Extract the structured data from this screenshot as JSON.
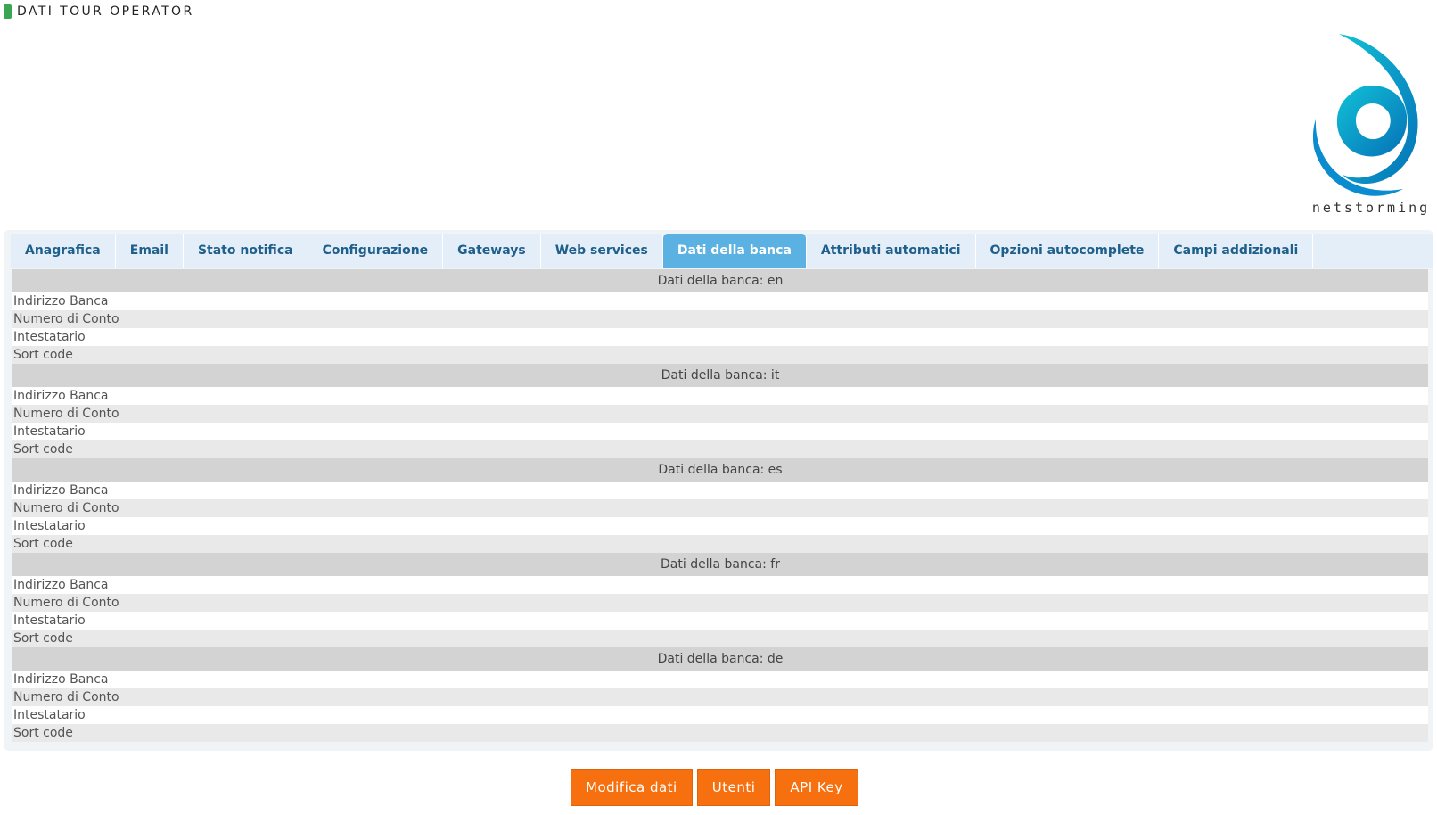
{
  "header": {
    "title": "DATI TOUR OPERATOR"
  },
  "logo": {
    "text": "netstorming",
    "colors": {
      "primary": "#0aa6c9",
      "dark": "#0571b8"
    }
  },
  "tabs": [
    {
      "label": "Anagrafica"
    },
    {
      "label": "Email"
    },
    {
      "label": "Stato notifica"
    },
    {
      "label": "Configurazione"
    },
    {
      "label": "Gateways"
    },
    {
      "label": "Web services"
    },
    {
      "label": "Dati della banca",
      "active": true
    },
    {
      "label": "Attributi automatici"
    },
    {
      "label": "Opzioni autocomplete"
    },
    {
      "label": "Campi addizionali"
    }
  ],
  "sections": [
    {
      "title": "Dati della banca: en",
      "rows": [
        "Indirizzo Banca",
        "Numero di Conto",
        "Intestatario",
        "Sort code"
      ]
    },
    {
      "title": "Dati della banca: it",
      "rows": [
        "Indirizzo Banca",
        "Numero di Conto",
        "Intestatario",
        "Sort code"
      ]
    },
    {
      "title": "Dati della banca: es",
      "rows": [
        "Indirizzo Banca",
        "Numero di Conto",
        "Intestatario",
        "Sort code"
      ]
    },
    {
      "title": "Dati della banca: fr",
      "rows": [
        "Indirizzo Banca",
        "Numero di Conto",
        "Intestatario",
        "Sort code"
      ]
    },
    {
      "title": "Dati della banca: de",
      "rows": [
        "Indirizzo Banca",
        "Numero di Conto",
        "Intestatario",
        "Sort code"
      ]
    }
  ],
  "buttons": {
    "modify": "Modifica dati",
    "users": "Utenti",
    "api_key": "API Key"
  },
  "colors": {
    "accent": "#f7700f",
    "tab_active": "#5bb1e2",
    "tab_text": "#1f5f8b",
    "header_marker": "#3aa655"
  }
}
